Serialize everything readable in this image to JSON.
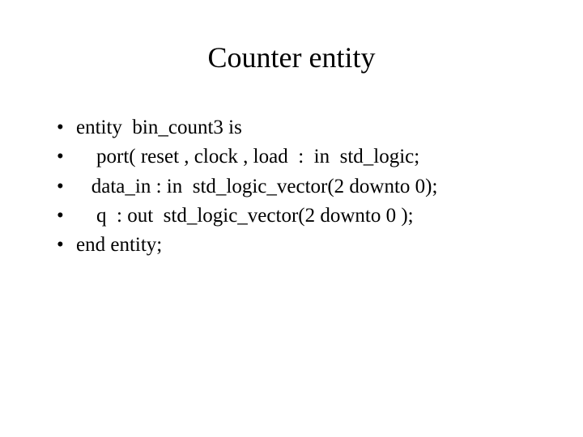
{
  "title": "Counter entity",
  "bullets": [
    "entity  bin_count3 is",
    "    port( reset , clock , load  :  in  std_logic;",
    "   data_in : in  std_logic_vector(2 downto 0);",
    "    q  : out  std_logic_vector(2 downto 0 );",
    "end entity;"
  ]
}
